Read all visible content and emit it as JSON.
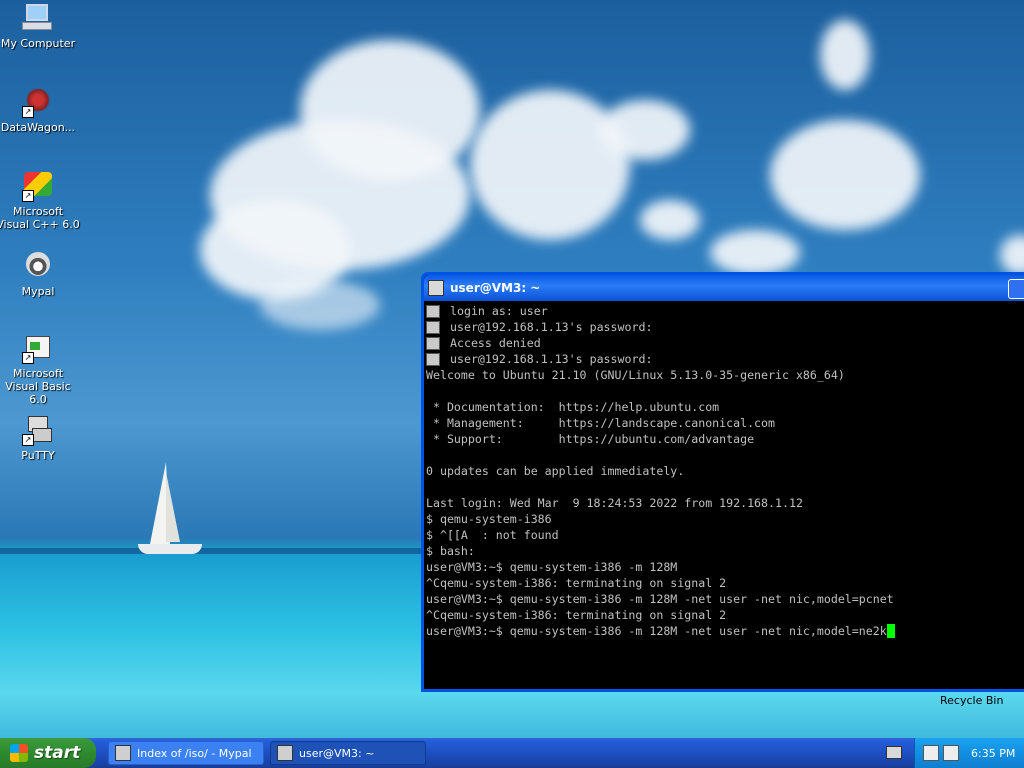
{
  "desktop": {
    "icons": [
      {
        "label": "My Computer",
        "icon": "computer-icon"
      },
      {
        "label": "DataWagon...",
        "icon": "datawagon-icon"
      },
      {
        "label": "Microsoft Visual C++ 6.0",
        "icon": "visual-cpp-icon"
      },
      {
        "label": "Mypal",
        "icon": "mypal-icon"
      },
      {
        "label": "Microsoft Visual Basic 6.0",
        "icon": "visual-basic-icon"
      },
      {
        "label": "PuTTY",
        "icon": "putty-icon"
      }
    ],
    "recycle_bin": "Recycle Bin"
  },
  "window": {
    "title": "user@VM3: ~",
    "terminal_lines": [
      {
        "text": "login as: user",
        "icon": true
      },
      {
        "text": "user@192.168.1.13's password:",
        "icon": true
      },
      {
        "text": "Access denied",
        "icon": true
      },
      {
        "text": "user@192.168.1.13's password:",
        "icon": true
      },
      {
        "text": "Welcome to Ubuntu 21.10 (GNU/Linux 5.13.0-35-generic x86_64)",
        "icon": false
      },
      {
        "text": "",
        "icon": false
      },
      {
        "text": " * Documentation:  https://help.ubuntu.com",
        "icon": false
      },
      {
        "text": " * Management:     https://landscape.canonical.com",
        "icon": false
      },
      {
        "text": " * Support:        https://ubuntu.com/advantage",
        "icon": false
      },
      {
        "text": "",
        "icon": false
      },
      {
        "text": "0 updates can be applied immediately.",
        "icon": false
      },
      {
        "text": "",
        "icon": false
      },
      {
        "text": "Last login: Wed Mar  9 18:24:53 2022 from 192.168.1.12",
        "icon": false
      },
      {
        "text": "$ qemu-system-i386",
        "icon": false
      },
      {
        "text": "$ ^[[A  : not found",
        "icon": false
      },
      {
        "text": "$ bash:",
        "icon": false
      },
      {
        "text": "user@VM3:~$ qemu-system-i386 -m 128M",
        "icon": false
      },
      {
        "text": "^Cqemu-system-i386: terminating on signal 2",
        "icon": false
      },
      {
        "text": "user@VM3:~$ qemu-system-i386 -m 128M -net user -net nic,model=pcnet",
        "icon": false
      },
      {
        "text": "^Cqemu-system-i386: terminating on signal 2",
        "icon": false
      },
      {
        "text": "user@VM3:~$ qemu-system-i386 -m 128M -net user -net nic,model=ne2k",
        "icon": false,
        "cursor": true
      }
    ]
  },
  "taskbar": {
    "start_label": "start",
    "tasks": [
      {
        "label": "Index of /iso/ - Mypal",
        "icon": "mypal-icon",
        "active": false
      },
      {
        "label": "user@VM3: ~",
        "icon": "putty-icon",
        "active": true
      }
    ],
    "clock": "6:35 PM"
  }
}
